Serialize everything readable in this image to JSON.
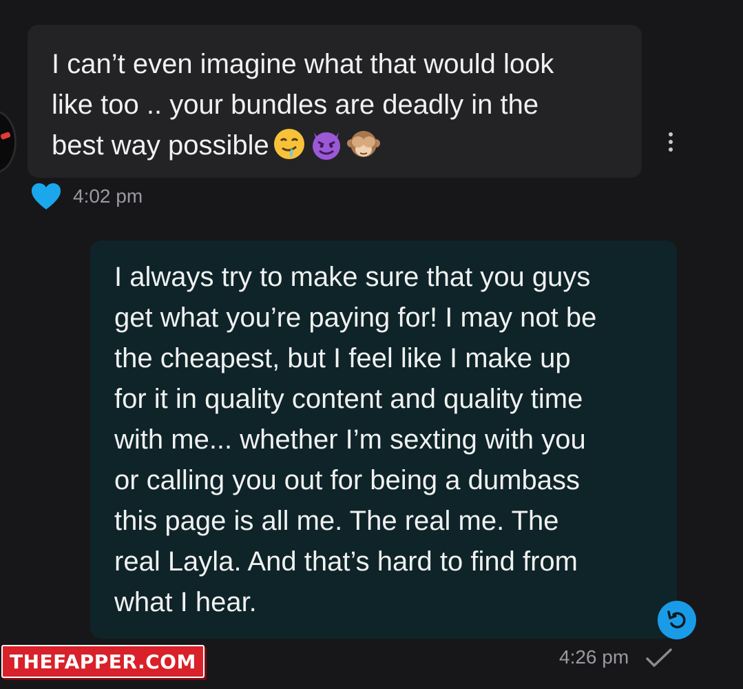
{
  "incoming_message": {
    "text": "I can’t even imagine what that would look\nlike too .. your bundles are deadly in the\nbest way possible",
    "emojis": [
      "drooling-face",
      "smiling-face-with-horns",
      "see-no-evil-monkey"
    ],
    "time": "4:02 pm",
    "reaction": "blue-heart"
  },
  "outgoing_message": {
    "lines": [
      "I always try to make sure that you guys",
      "get what you’re paying for! I may not be",
      "the cheapest, but I feel like I make up",
      "for it in quality content and quality time",
      "with me... whether I’m sexting with you",
      "or calling you out for being a dumbass",
      "this page is all me. The real me. The",
      "real Layla. And that’s hard to find from",
      "what I hear."
    ],
    "time": "4:26 pm",
    "status": "check-icon"
  },
  "watermark": {
    "text": "THEFAPPER.COM"
  },
  "colors": {
    "background": "#17171a",
    "incoming_bubble": "#232326",
    "outgoing_bubble": "#0e2429",
    "accent_blue": "#1a9be8"
  }
}
